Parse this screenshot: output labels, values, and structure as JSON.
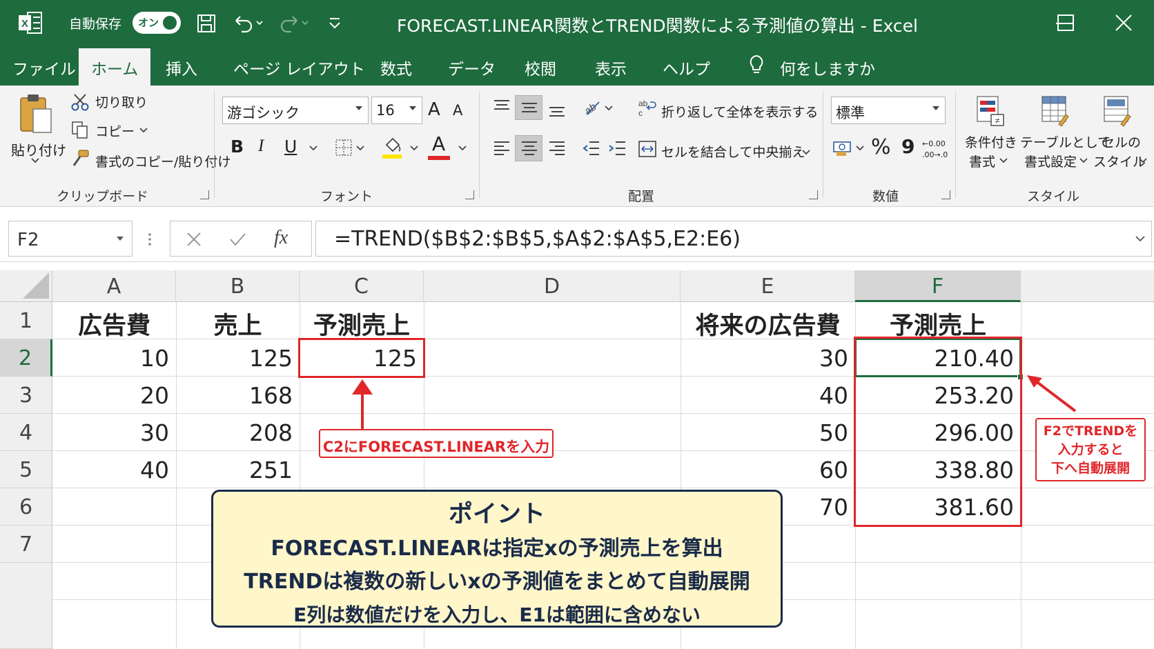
{
  "title_bar": {
    "autosave_label": "自動保存",
    "autosave_state": "オン",
    "title": "FORECAST.LINEAR関数とTREND関数による予測値の算出  -  Excel"
  },
  "menu_tabs": [
    {
      "label": "ファイル"
    },
    {
      "label": "ホーム",
      "active": true
    },
    {
      "label": "挿入"
    },
    {
      "label": "ページ レイアウト"
    },
    {
      "label": "数式"
    },
    {
      "label": "データ"
    },
    {
      "label": "校閲"
    },
    {
      "label": "表示"
    },
    {
      "label": "ヘルプ"
    },
    {
      "label": "何をしますか"
    }
  ],
  "ribbon": {
    "clipboard": {
      "paste": "貼り付け",
      "cut": "切り取り",
      "copy": "コピー",
      "format_painter": "書式のコピー/貼り付け",
      "group": "クリップボード"
    },
    "font": {
      "font_name": "游ゴシック",
      "font_size": "16",
      "bold": "B",
      "italic": "I",
      "underline": "U",
      "grow": "A",
      "shrink": "A",
      "font_color_glyph": "A",
      "highlight_color": "#ffe600",
      "font_color": "#e0262a",
      "group": "フォント"
    },
    "alignment": {
      "wrap_text": "折り返して全体を表示する",
      "merge_center": "セルを結合して中央揃え",
      "group": "配置"
    },
    "number": {
      "format": "標準",
      "percent": "%",
      "comma": "9",
      "inc_decimal": "←0.00",
      "dec_decimal": ".00→.0",
      "group": "数値"
    },
    "styles": {
      "conditional": [
        "条件付き",
        "書式"
      ],
      "table": [
        "テーブルとして",
        "書式設定"
      ],
      "cell_styles": [
        "セルの",
        "スタイル"
      ],
      "group": "スタイル"
    }
  },
  "formula_bar": {
    "name_box": "F2",
    "fx": "fx",
    "formula": "=TREND($B$2:$B$5,$A$2:$A$5,E2:E6)"
  },
  "sheet": {
    "columns": [
      "A",
      "B",
      "C",
      "D",
      "E",
      "F"
    ],
    "rows": [
      "1",
      "2",
      "3",
      "4",
      "5",
      "6",
      "7"
    ],
    "selected_column": "F",
    "selected_row": "2",
    "headers": {
      "A1": "広告費",
      "B1": "売上",
      "C1": "予測売上",
      "E1": "将来の広告費",
      "F1": "予測売上"
    },
    "ad_cost": [
      "10",
      "20",
      "30",
      "40"
    ],
    "sales": [
      "125",
      "168",
      "208",
      "251"
    ],
    "forecast_c2": "125",
    "future_ad_cost": [
      "30",
      "40",
      "50",
      "60",
      "70"
    ],
    "trend_values": [
      "210.40",
      "253.20",
      "296.00",
      "338.80",
      "381.60"
    ]
  },
  "annotations": {
    "c2_callout": "C2にFORECAST.LINEARを入力",
    "f2_callout": [
      "F2でTRENDを",
      "入力すると",
      "下へ自動展開"
    ],
    "point_title": "ポイント",
    "point_lines": [
      "FORECAST.LINEARは指定xの予測売上を算出",
      "TRENDは複数の新しいxの予測値をまとめて自動展開",
      "E列は数値だけを入力し、E1は範囲に含めない"
    ],
    "accent_color": "#e0262a",
    "excel_green": "#1e6b3e"
  }
}
